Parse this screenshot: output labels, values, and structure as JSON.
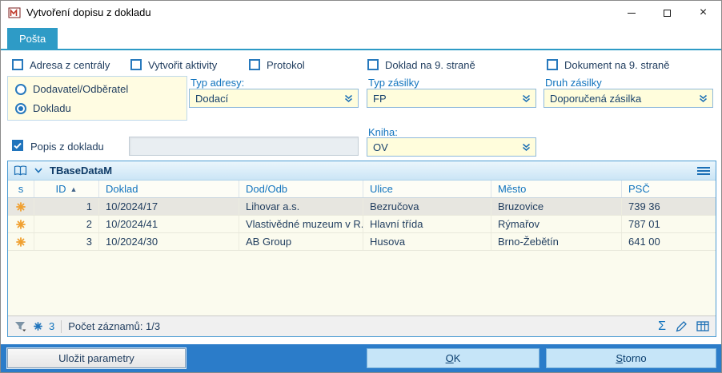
{
  "window": {
    "title": "Vytvoření dopisu z dokladu"
  },
  "tab": {
    "label": "Pošta"
  },
  "checkboxes": [
    {
      "label": "Adresa z centrály",
      "checked": false
    },
    {
      "label": "Vytvořit aktivity",
      "checked": false
    },
    {
      "label": "Protokol",
      "checked": false
    },
    {
      "label": "Doklad na 9. straně",
      "checked": false
    },
    {
      "label": "Dokument na 9. straně",
      "checked": false
    }
  ],
  "radios": [
    {
      "label": "Dodavatel/Odběratel",
      "selected": false
    },
    {
      "label": "Dokladu",
      "selected": true
    }
  ],
  "fields": {
    "typ_adresy": {
      "label": "Typ adresy:",
      "value": "Dodací"
    },
    "typ_zasilky": {
      "label": "Typ zásilky",
      "value": "FP"
    },
    "druh_zasilky": {
      "label": "Druh zásilky",
      "value": "Doporučená zásilka"
    },
    "popis_z_dokladu": {
      "label": "Popis z dokladu",
      "checked": true,
      "value": ""
    },
    "kniha": {
      "label": "Kniha:",
      "value": "OV"
    }
  },
  "grid": {
    "title": "TBaseDataM",
    "columns": {
      "s": "s",
      "id": "ID",
      "doklad": "Doklad",
      "dod_odb": "Dod/Odb",
      "ulice": "Ulice",
      "mesto": "Město",
      "psc": "PSČ"
    },
    "sort": {
      "column": "ID",
      "direction_icon": "▲"
    },
    "rows": [
      {
        "id": "1",
        "doklad": "10/2024/17",
        "dod_odb": "Lihovar a.s.",
        "ulice": "Bezručova",
        "mesto": "Bruzovice",
        "psc": "739 36"
      },
      {
        "id": "2",
        "doklad": "10/2024/41",
        "dod_odb": "Vlastivědné muzeum v R...",
        "ulice": "Hlavní třída",
        "mesto": "Rýmařov",
        "psc": "787 01"
      },
      {
        "id": "3",
        "doklad": "10/2024/30",
        "dod_odb": "AB Group",
        "ulice": "Husova",
        "mesto": "Brno-Žebětín",
        "psc": "641 00"
      }
    ],
    "status": {
      "count": "3",
      "records": "Počet záznamů: 1/3"
    }
  },
  "buttons": {
    "ulozit_parametry": "Uložit parametry",
    "ok_accel": "O",
    "ok_rest": "K",
    "storno_accel": "S",
    "storno_rest": "torno"
  },
  "icons": {
    "sum": "Σ",
    "close": "×"
  },
  "colors": {
    "accent_blue": "#2E9BC6",
    "label_blue": "#1274BE",
    "field_yellow": "#FFFDDC",
    "bottom_bar_blue": "#2B7CC9",
    "asterisk_orange": "#F0A030",
    "selected_row_gray": "#E7E6E0"
  }
}
